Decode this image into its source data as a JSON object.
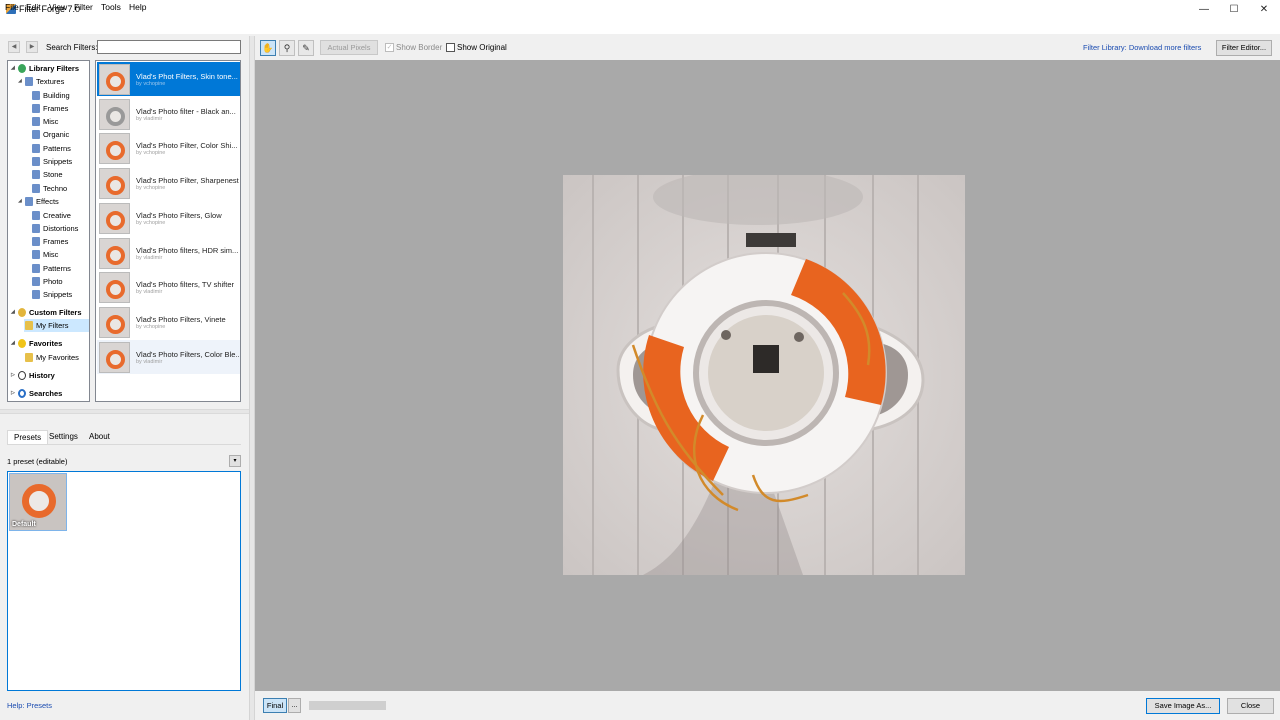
{
  "window": {
    "title": "Filter Forge 7.0",
    "minimize_glyph": "—",
    "maximize_glyph": "☐",
    "close_glyph": "✕"
  },
  "menu": [
    "File",
    "Edit",
    "View",
    "Filter",
    "Tools",
    "Help"
  ],
  "search": {
    "label": "Search Filters:",
    "value": "",
    "back_glyph": "◀",
    "forward_glyph": "▶"
  },
  "tree": {
    "library": "Library Filters",
    "textures": "Textures",
    "textures_items": [
      "Building",
      "Frames",
      "Misc",
      "Organic",
      "Patterns",
      "Snippets",
      "Stone",
      "Techno"
    ],
    "effects": "Effects",
    "effects_items": [
      "Creative",
      "Distortions",
      "Frames",
      "Misc",
      "Patterns",
      "Photo",
      "Snippets"
    ],
    "custom": "Custom Filters",
    "my_filters": "My Filters",
    "favorites": "Favorites",
    "my_favorites": "My Favorites",
    "history": "History",
    "searches": "Searches"
  },
  "filters": [
    {
      "name": "Vlad's Phot Filters, Skin tone...",
      "author": "by vchopine"
    },
    {
      "name": "Vlad's Photo filter - Black an...",
      "author": "by vladimir"
    },
    {
      "name": "Vlad's Photo Filter, Color Shi...",
      "author": "by vchopine"
    },
    {
      "name": "Vlad's Photo Filter, Sharpenest",
      "author": "by vchopine"
    },
    {
      "name": "Vlad's Photo Filters, Glow",
      "author": "by vchopine"
    },
    {
      "name": "Vlad's Photo filters, HDR sim...",
      "author": "by vladimir"
    },
    {
      "name": "Vlad's Photo filters, TV shifter",
      "author": "by vladimir"
    },
    {
      "name": "Vlad's Photo Filters, Vinete",
      "author": "by vchopine"
    },
    {
      "name": "Vlad's Photo Filters, Color Ble...",
      "author": "by vladimir"
    }
  ],
  "tabs": [
    "Presets",
    "Settings",
    "About"
  ],
  "presets": {
    "count_label": "1 preset (editable)",
    "default_label": "Default"
  },
  "help": "Help: Presets",
  "toolbar": {
    "actual_pixels": "Actual Pixels",
    "show_border": "Show Border",
    "show_original": "Show Original",
    "library_link": "Filter Library: Download more filters",
    "filter_editor": "Filter Editor..."
  },
  "bottom": {
    "final": "Final",
    "more": "...",
    "save": "Save Image As...",
    "close": "Close"
  },
  "colors": {
    "selection": "#0078d7",
    "canvas_bg": "#a9a9a9",
    "buoy_orange": "#e8641f",
    "link": "#1a4bb0"
  }
}
